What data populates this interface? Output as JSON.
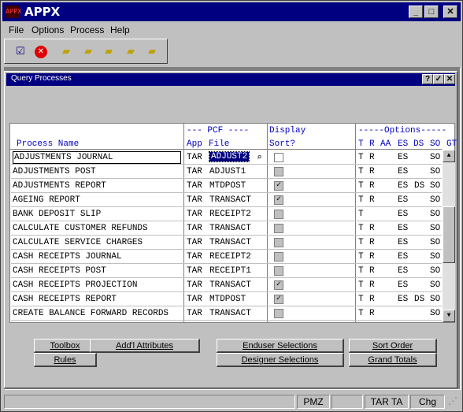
{
  "app": {
    "title": "APPX",
    "icon_text": "APPX"
  },
  "menu": [
    "File",
    "Options",
    "Process",
    "Help"
  ],
  "toolbar": [
    "ok-icon",
    "cancel-icon",
    "folder-new-icon",
    "folder-up-icon",
    "folder-search-icon",
    "folder-delete-icon",
    "folder-edit-icon"
  ],
  "child": {
    "title": "Query Processes"
  },
  "headers": {
    "pcf_group": "--- PCF ----",
    "display": "Display",
    "options_group": "-----Options-----",
    "process_name": "Process Name",
    "app": "App",
    "file": "File",
    "sort": "Sort?",
    "t": "T",
    "r": "R",
    "aa": "AA",
    "es": "ES",
    "ds": "DS",
    "so": "SO",
    "gt": "GT"
  },
  "rows": [
    {
      "name": "ADJUSTMENTS JOURNAL",
      "app": "TAR",
      "file": "ADJUST2",
      "sort": false,
      "t": "T",
      "r": "R",
      "aa": "",
      "es": "ES",
      "ds": "",
      "so": "SO"
    },
    {
      "name": "ADJUSTMENTS POST",
      "app": "TAR",
      "file": "ADJUST1",
      "sort": false,
      "t": "T",
      "r": "R",
      "aa": "",
      "es": "ES",
      "ds": "",
      "so": "SO"
    },
    {
      "name": "ADJUSTMENTS REPORT",
      "app": "TAR",
      "file": "MTDPOST",
      "sort": true,
      "t": "T",
      "r": "R",
      "aa": "",
      "es": "ES",
      "ds": "DS",
      "so": "SO"
    },
    {
      "name": "AGEING REPORT",
      "app": "TAR",
      "file": "TRANSACT",
      "sort": true,
      "t": "T",
      "r": "R",
      "aa": "",
      "es": "ES",
      "ds": "",
      "so": "SO"
    },
    {
      "name": "BANK DEPOSIT SLIP",
      "app": "TAR",
      "file": "RECEIPT2",
      "sort": false,
      "t": "T",
      "r": "",
      "aa": "",
      "es": "ES",
      "ds": "",
      "so": "SO"
    },
    {
      "name": "CALCULATE CUSTOMER REFUNDS",
      "app": "TAR",
      "file": "TRANSACT",
      "sort": false,
      "t": "T",
      "r": "R",
      "aa": "",
      "es": "ES",
      "ds": "",
      "so": "SO"
    },
    {
      "name": "CALCULATE SERVICE CHARGES",
      "app": "TAR",
      "file": "TRANSACT",
      "sort": false,
      "t": "T",
      "r": "R",
      "aa": "",
      "es": "ES",
      "ds": "",
      "so": "SO"
    },
    {
      "name": "CASH RECEIPTS JOURNAL",
      "app": "TAR",
      "file": "RECEIPT2",
      "sort": false,
      "t": "T",
      "r": "R",
      "aa": "",
      "es": "ES",
      "ds": "",
      "so": "SO"
    },
    {
      "name": "CASH RECEIPTS POST",
      "app": "TAR",
      "file": "RECEIPT1",
      "sort": false,
      "t": "T",
      "r": "R",
      "aa": "",
      "es": "ES",
      "ds": "",
      "so": "SO"
    },
    {
      "name": "CASH RECEIPTS PROJECTION",
      "app": "TAR",
      "file": "TRANSACT",
      "sort": true,
      "t": "T",
      "r": "R",
      "aa": "",
      "es": "ES",
      "ds": "",
      "so": "SO"
    },
    {
      "name": "CASH RECEIPTS REPORT",
      "app": "TAR",
      "file": "MTDPOST",
      "sort": true,
      "t": "T",
      "r": "R",
      "aa": "",
      "es": "ES",
      "ds": "DS",
      "so": "SO"
    },
    {
      "name": "CREATE BALANCE FORWARD RECORDS",
      "app": "TAR",
      "file": "TRANSACT",
      "sort": false,
      "t": "T",
      "r": "R",
      "aa": "",
      "es": "",
      "ds": "",
      "so": "SO"
    }
  ],
  "buttons": {
    "toolbox": "Toolbox",
    "rules": "Rules",
    "addl": "Add'l Attributes",
    "enduser": "Enduser Selections",
    "designer": "Designer Selections",
    "sort_order": "Sort Order",
    "grand_totals": "Grand Totals"
  },
  "status": [
    "PMZ",
    "TAR TA",
    "Chg"
  ]
}
